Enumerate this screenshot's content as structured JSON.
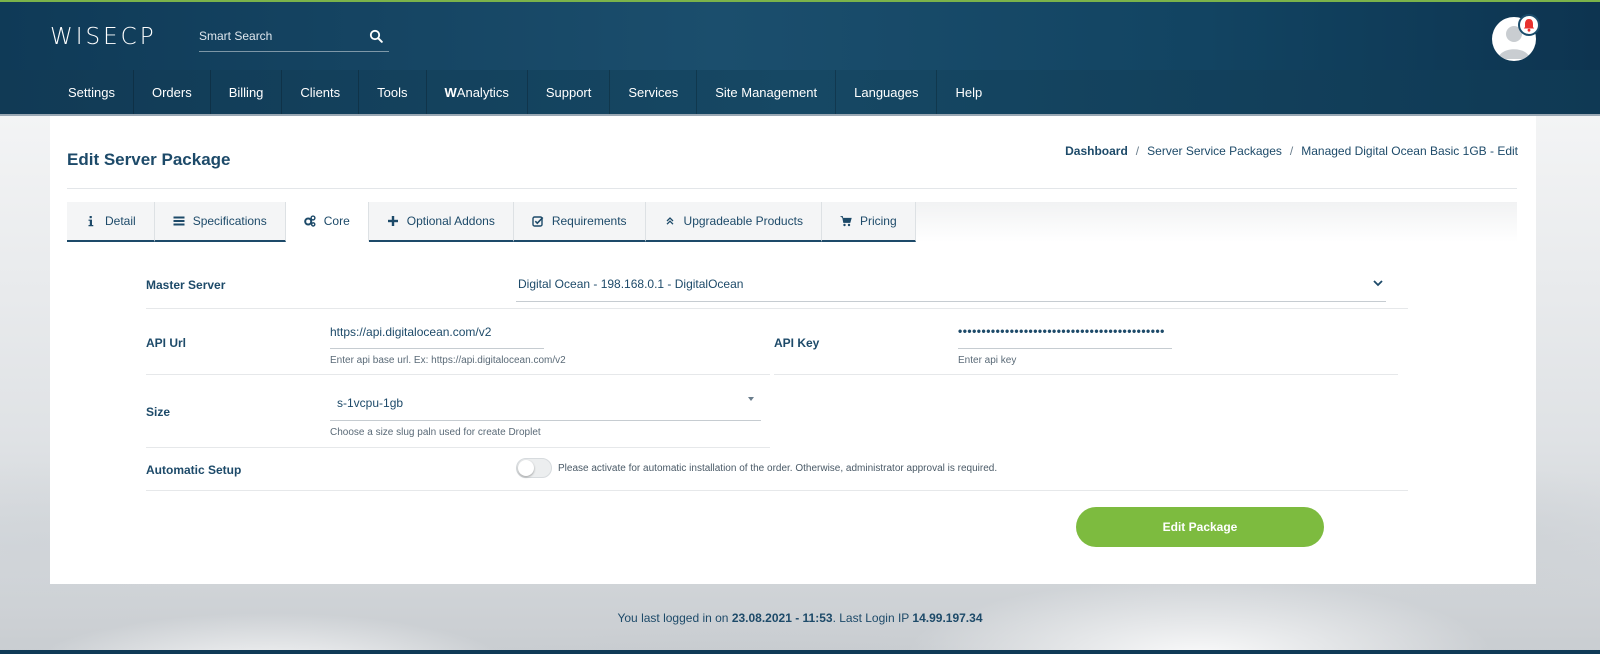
{
  "app": {
    "logo": "WISECP"
  },
  "search": {
    "placeholder": "Smart Search"
  },
  "nav": {
    "items": [
      {
        "label": "Settings"
      },
      {
        "label": "Orders"
      },
      {
        "label": "Billing"
      },
      {
        "label": "Clients"
      },
      {
        "label": "Tools"
      },
      {
        "label_bold": "W",
        "label_rest": "Analytics"
      },
      {
        "label": "Support"
      },
      {
        "label": "Services"
      },
      {
        "label": "Site Management"
      },
      {
        "label": "Languages"
      },
      {
        "label": "Help"
      }
    ]
  },
  "page": {
    "title": "Edit Server Package",
    "breadcrumb": [
      "Dashboard",
      "Server Service Packages",
      "Managed Digital Ocean Basic 1GB - Edit"
    ]
  },
  "tabs": [
    {
      "label": "Detail",
      "icon": "info-icon",
      "active": false
    },
    {
      "label": "Specifications",
      "icon": "list-icon",
      "active": false
    },
    {
      "label": "Core",
      "icon": "gears-icon",
      "active": true
    },
    {
      "label": "Optional Addons",
      "icon": "plus-icon",
      "active": false
    },
    {
      "label": "Requirements",
      "icon": "checkbox-icon",
      "active": false
    },
    {
      "label": "Upgradeable Products",
      "icon": "double-chevron-up-icon",
      "active": false
    },
    {
      "label": "Pricing",
      "icon": "cart-icon",
      "active": false
    }
  ],
  "form": {
    "master_server": {
      "label": "Master Server",
      "value": "Digital Ocean - 198.168.0.1 - DigitalOcean"
    },
    "api_url": {
      "label": "API Url",
      "value": "https://api.digitalocean.com/v2",
      "helper": "Enter api base url. Ex: https://api.digitalocean.com/v2"
    },
    "api_key": {
      "label": "API Key",
      "value": "••••••••••••••••••••••••••••••••••••••••••••",
      "helper": "Enter api key"
    },
    "size": {
      "label": "Size",
      "value": "s-1vcpu-1gb",
      "helper": "Choose a size slug paln used for create Droplet"
    },
    "automatic_setup": {
      "label": "Automatic Setup",
      "description": "Please activate for automatic installation of the order. Otherwise, administrator approval is required.",
      "enabled": false
    },
    "submit_label": "Edit Package"
  },
  "footer": {
    "prefix": "You last logged in on ",
    "datetime": "23.08.2021 - 11:53",
    "middle": ". Last Login IP ",
    "ip": "14.99.197.34"
  },
  "colors": {
    "brand_navy": "#1d4a69",
    "accent_green": "#7dbb3f",
    "header_dark": "#0f3a57"
  }
}
